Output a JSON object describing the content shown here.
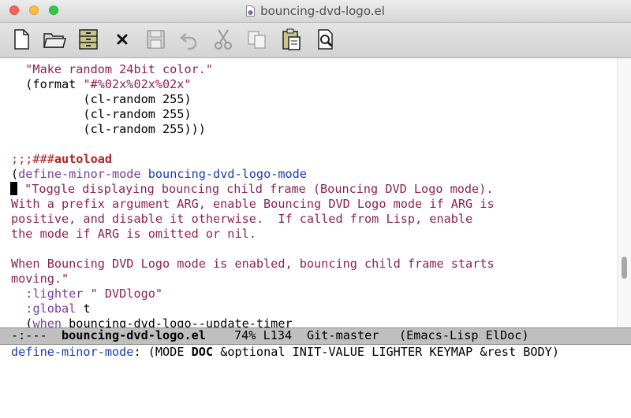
{
  "window": {
    "title": "bouncing-dvd-logo.el"
  },
  "toolbar": {
    "items": [
      "new-file",
      "open-folder",
      "dired",
      "close",
      "save",
      "undo",
      "cut",
      "copy",
      "paste",
      "search"
    ]
  },
  "editor": {
    "lines": [
      "  \"Make random 24bit color.\"",
      "  (format \"#%02x%02x%02x\"",
      "          (cl-random 255)",
      "          (cl-random 255)",
      "          (cl-random 255)))",
      "",
      ";;;###autoload",
      "(define-minor-mode bouncing-dvd-logo-mode",
      " \"Toggle displaying bouncing child frame (Bouncing DVD Logo mode).",
      "With a prefix argument ARG, enable Bouncing DVD Logo mode if ARG is",
      "positive, and disable it otherwise.  If called from Lisp, enable",
      "the mode if ARG is omitted or nil.",
      "",
      "When Bouncing DVD Logo mode is enabled, bouncing child frame starts",
      "moving.\"",
      "  :lighter \" DVDlogo\"",
      "  :global t",
      "  (when bouncing-dvd-logo--update-timer"
    ]
  },
  "modeline": {
    "status": "-:---",
    "buffer_name": "bouncing-dvd-logo.el",
    "position": "74% L134",
    "vc": "Git-master",
    "modes": "(Emacs-Lisp ElDoc)"
  },
  "echo": {
    "fn_name": "define-minor-mode",
    "colon": ":",
    "args_pre": " (MODE ",
    "args_bold": "DOC",
    "args_post": " &optional INIT-VALUE LIGHTER KEYMAP &rest BODY)"
  },
  "colors": {
    "string": "#8b2252",
    "keyword": "#7a3e9d",
    "function": "#1a3cb0",
    "comment": "#b22222",
    "modeline_bg": "#bfbfbf"
  }
}
